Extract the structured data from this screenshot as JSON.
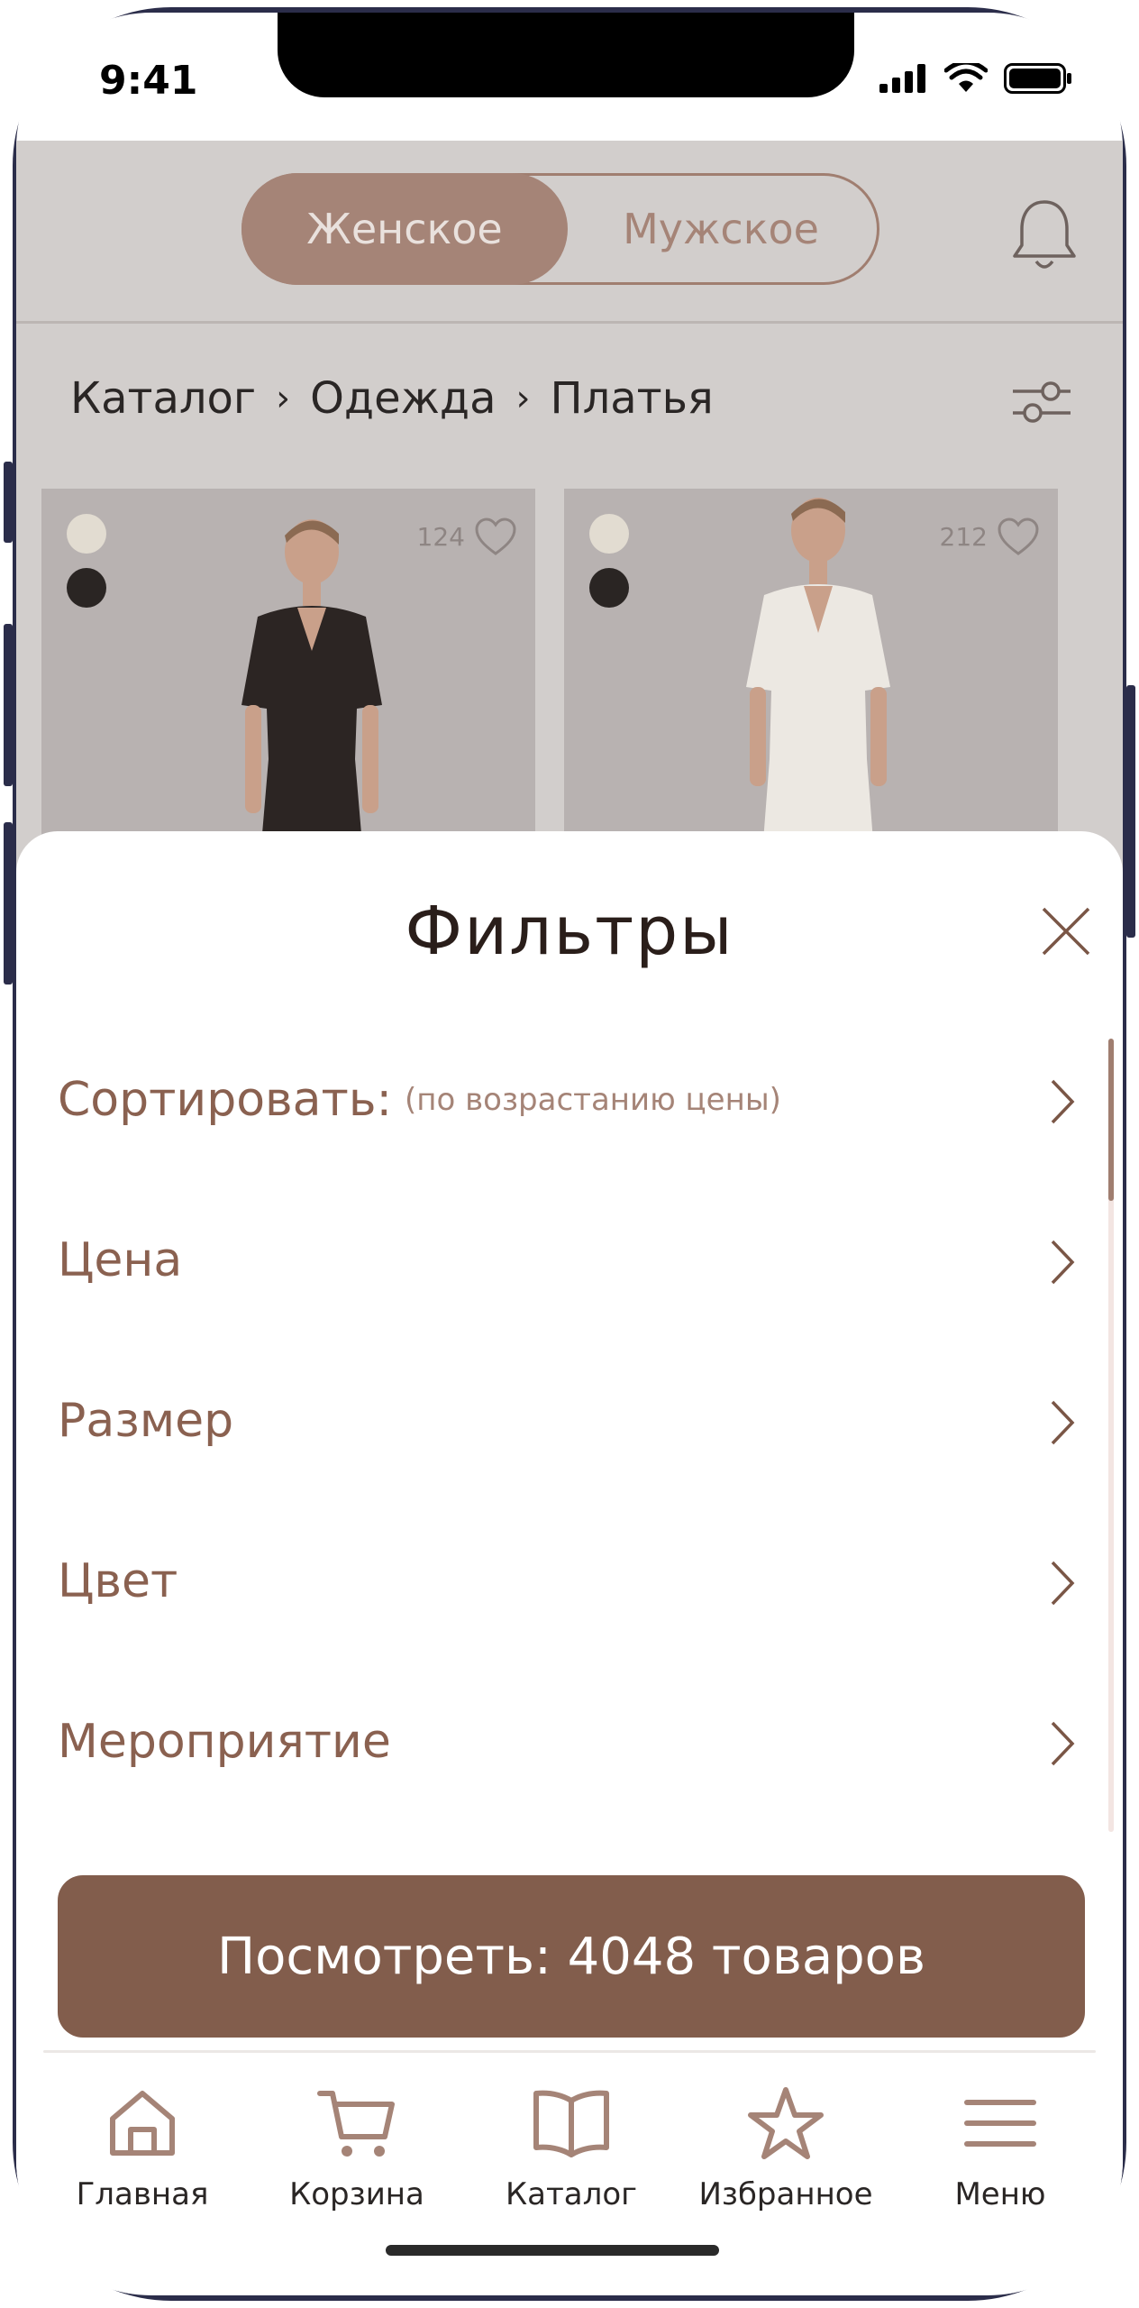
{
  "status_bar": {
    "time": "9:41"
  },
  "header": {
    "segment": {
      "active": "Женское",
      "inactive": "Мужское"
    }
  },
  "breadcrumb": [
    "Каталог",
    "Одежда",
    "Платья"
  ],
  "products": [
    {
      "likes": "124",
      "colors": [
        "#e2dcd1",
        "#2a2523"
      ],
      "dress_color": "#2c2523"
    },
    {
      "likes": "212",
      "colors": [
        "#e2dcd1",
        "#2a2523"
      ],
      "dress_color": "#ece8e2"
    }
  ],
  "filters_sheet": {
    "title": "Фильтры",
    "rows": [
      {
        "label": "Сортировать:",
        "sub": "(по возрастанию цены)"
      },
      {
        "label": "Цена",
        "sub": ""
      },
      {
        "label": "Размер",
        "sub": ""
      },
      {
        "label": "Цвет",
        "sub": ""
      },
      {
        "label": "Мероприятие",
        "sub": ""
      }
    ],
    "cta": "Посмотреть: 4048 товаров"
  },
  "tabbar": [
    {
      "icon": "home-icon",
      "label": "Главная"
    },
    {
      "icon": "cart-icon",
      "label": "Корзина"
    },
    {
      "icon": "book-icon",
      "label": "Каталог"
    },
    {
      "icon": "star-icon",
      "label": "Избранное"
    },
    {
      "icon": "menu-icon",
      "label": "Меню"
    }
  ],
  "colors": {
    "accent": "#825d4c",
    "accent_light": "#a58477",
    "text_brown": "#8a6150"
  }
}
